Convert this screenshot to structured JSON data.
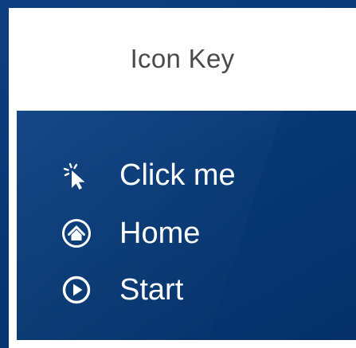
{
  "title": "Icon Key",
  "items": [
    {
      "icon": "click-cursor-icon",
      "label": "Click me"
    },
    {
      "icon": "home-icon",
      "label": "Home"
    },
    {
      "icon": "play-start-icon",
      "label": "Start"
    }
  ],
  "colors": {
    "frame": "#0a3a78",
    "panel": "#073873",
    "title_text": "#4a4a4a",
    "label_text": "#ffffff"
  }
}
